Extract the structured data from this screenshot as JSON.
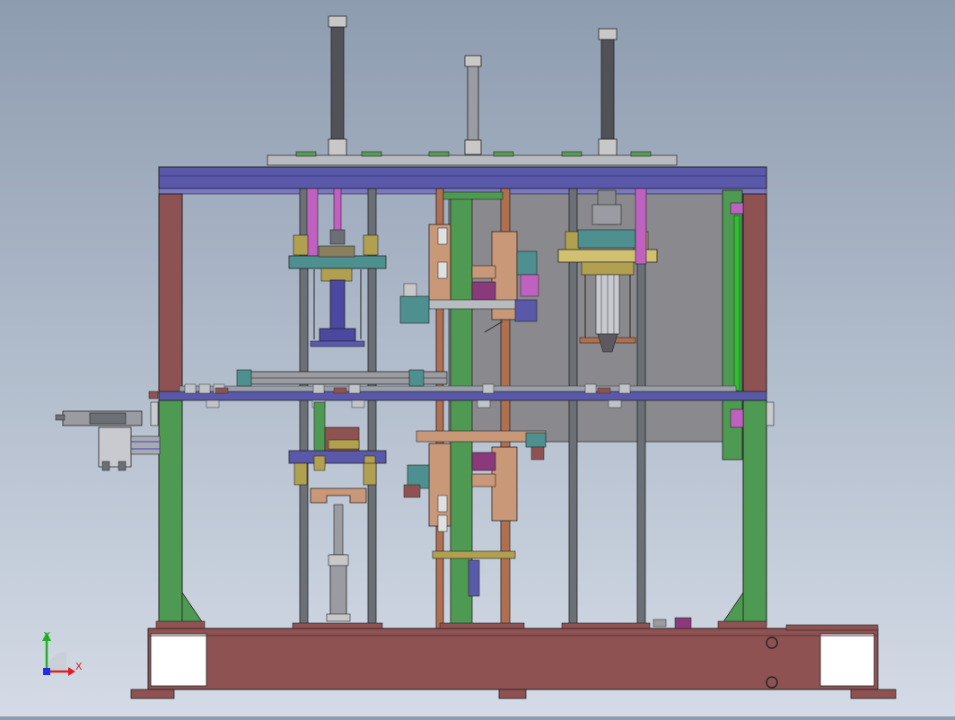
{
  "viewport": {
    "background_top": "#8e9cb0",
    "background_bottom": "#d4dbe6"
  },
  "triad": {
    "x_label": "X",
    "y_label": "Y",
    "x_color": "#e02020",
    "y_color": "#20b020",
    "z_color": "#2030e0"
  },
  "colors": {
    "frame_red": "#8f5252",
    "frame_green": "#4f9a52",
    "top_blue": "#5a58a8",
    "rail_gray": "#6b6f76",
    "copper": "#b07050",
    "plate_gray": "#8a8a8e",
    "teal": "#4e8f90",
    "gold": "#b0a050",
    "pink": "#c060c0",
    "outline": "#222222"
  }
}
